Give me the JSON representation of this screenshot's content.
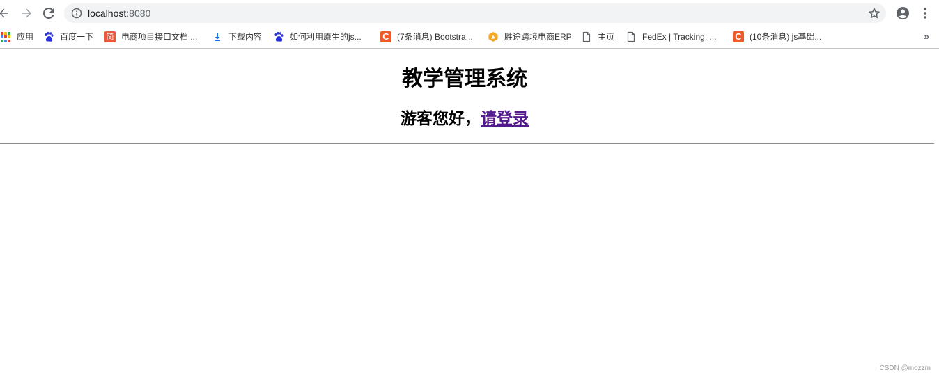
{
  "browser": {
    "url_host": "localhost",
    "url_port": ":8080",
    "icons": {
      "back": "arrow-left-icon",
      "forward": "arrow-right-icon",
      "reload": "reload-icon",
      "info": "info-icon",
      "star": "star-icon",
      "account": "account-icon",
      "menu": "kebab-menu-icon"
    }
  },
  "bookmarks": {
    "items": [
      {
        "label": "应用",
        "icon": "apps-grid-icon"
      },
      {
        "label": "百度一下",
        "icon": "baidu-paw-icon"
      },
      {
        "label": "电商项目接口文档 ...",
        "icon": "jianshu-icon"
      },
      {
        "label": "下载内容",
        "icon": "download-icon"
      },
      {
        "label": "如何利用原生的js...",
        "icon": "baidu-paw-icon"
      },
      {
        "label": "(7条消息) Bootstra...",
        "icon": "csdn-icon"
      },
      {
        "label": "胜途跨境电商ERP",
        "icon": "shengtu-icon"
      },
      {
        "label": "主页",
        "icon": "page-icon"
      },
      {
        "label": "FedEx | Tracking, ...",
        "icon": "page-icon"
      },
      {
        "label": "(10条消息) js基础...",
        "icon": "csdn-icon"
      }
    ],
    "more": "»"
  },
  "page": {
    "title": "教学管理系统",
    "greeting_prefix": "游客您好，",
    "login_link": "请登录"
  },
  "watermark": "CSDN @mozzm",
  "colors": {
    "link_visited": "#551a8b",
    "csdn": "#f0592a",
    "baidu": "#2932e1",
    "omnibox_bg": "#f1f3f4"
  }
}
